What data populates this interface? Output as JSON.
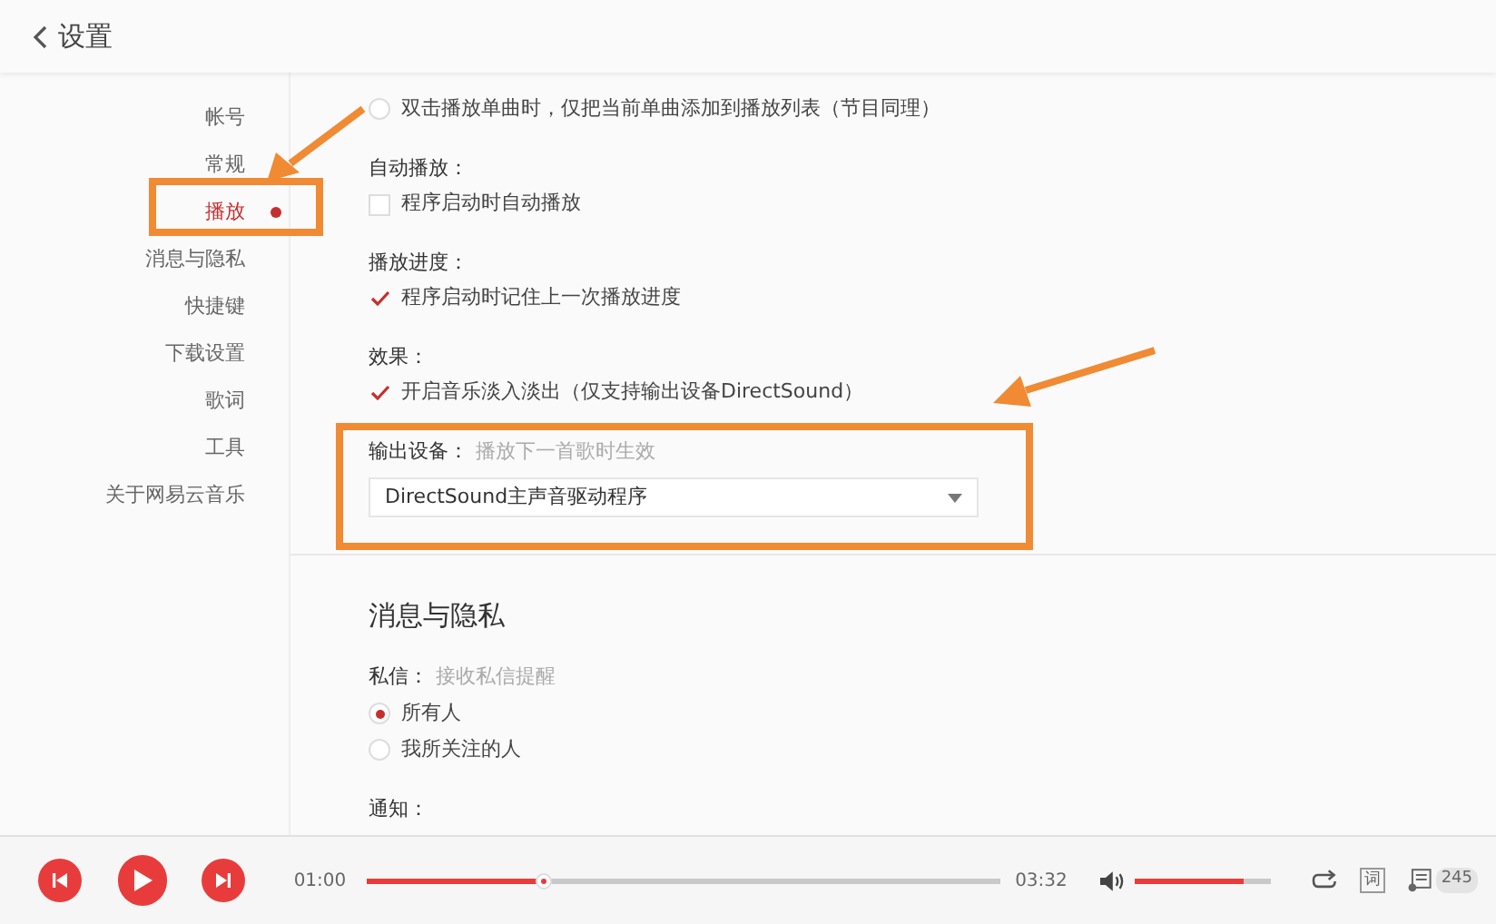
{
  "header": {
    "title": "设置"
  },
  "sidebar": {
    "items": [
      {
        "label": "帐号",
        "selected": false
      },
      {
        "label": "常规",
        "selected": false
      },
      {
        "label": "播放",
        "selected": true
      },
      {
        "label": "消息与隐私",
        "selected": false
      },
      {
        "label": "快捷键",
        "selected": false
      },
      {
        "label": "下载设置",
        "selected": false
      },
      {
        "label": "歌词",
        "selected": false
      },
      {
        "label": "工具",
        "selected": false
      },
      {
        "label": "关于网易云音乐",
        "selected": false
      }
    ]
  },
  "playback": {
    "lines": [
      {
        "kind": "radio",
        "label": "双击播放单曲时，仅把当前单曲添加到播放列表（节目同理）",
        "selected": false
      },
      {
        "kind": "label",
        "text": "自动播放："
      },
      {
        "kind": "checkbox",
        "label": "程序启动时自动播放",
        "checked": false
      },
      {
        "kind": "label",
        "text": "播放进度："
      },
      {
        "kind": "checkbox",
        "label": "程序启动时记住上一次播放进度",
        "checked": true
      },
      {
        "kind": "label",
        "text": "效果："
      },
      {
        "kind": "checkbox",
        "label": "开启音乐淡入淡出（仅支持输出设备DirectSound）",
        "checked": true
      },
      {
        "kind": "label",
        "text": "输出设备：",
        "hint": "播放下一首歌时生效"
      },
      {
        "kind": "select",
        "value": "DirectSound主声音驱动程序"
      }
    ]
  },
  "privacy": {
    "title": "消息与隐私",
    "lines": [
      {
        "kind": "label",
        "text": "私信：",
        "hint": "接收私信提醒"
      },
      {
        "kind": "radio",
        "label": "所有人",
        "selected": true
      },
      {
        "kind": "radio",
        "label": "我所关注的人",
        "selected": false
      },
      {
        "kind": "label",
        "text": "通知："
      }
    ]
  },
  "player": {
    "elapsed": "01:00",
    "progress": {
      "level": 0.28
    },
    "duration": "03:32",
    "volume": {
      "level": 0.8
    },
    "lyrics_button": "词",
    "playlist_count": "245"
  }
}
